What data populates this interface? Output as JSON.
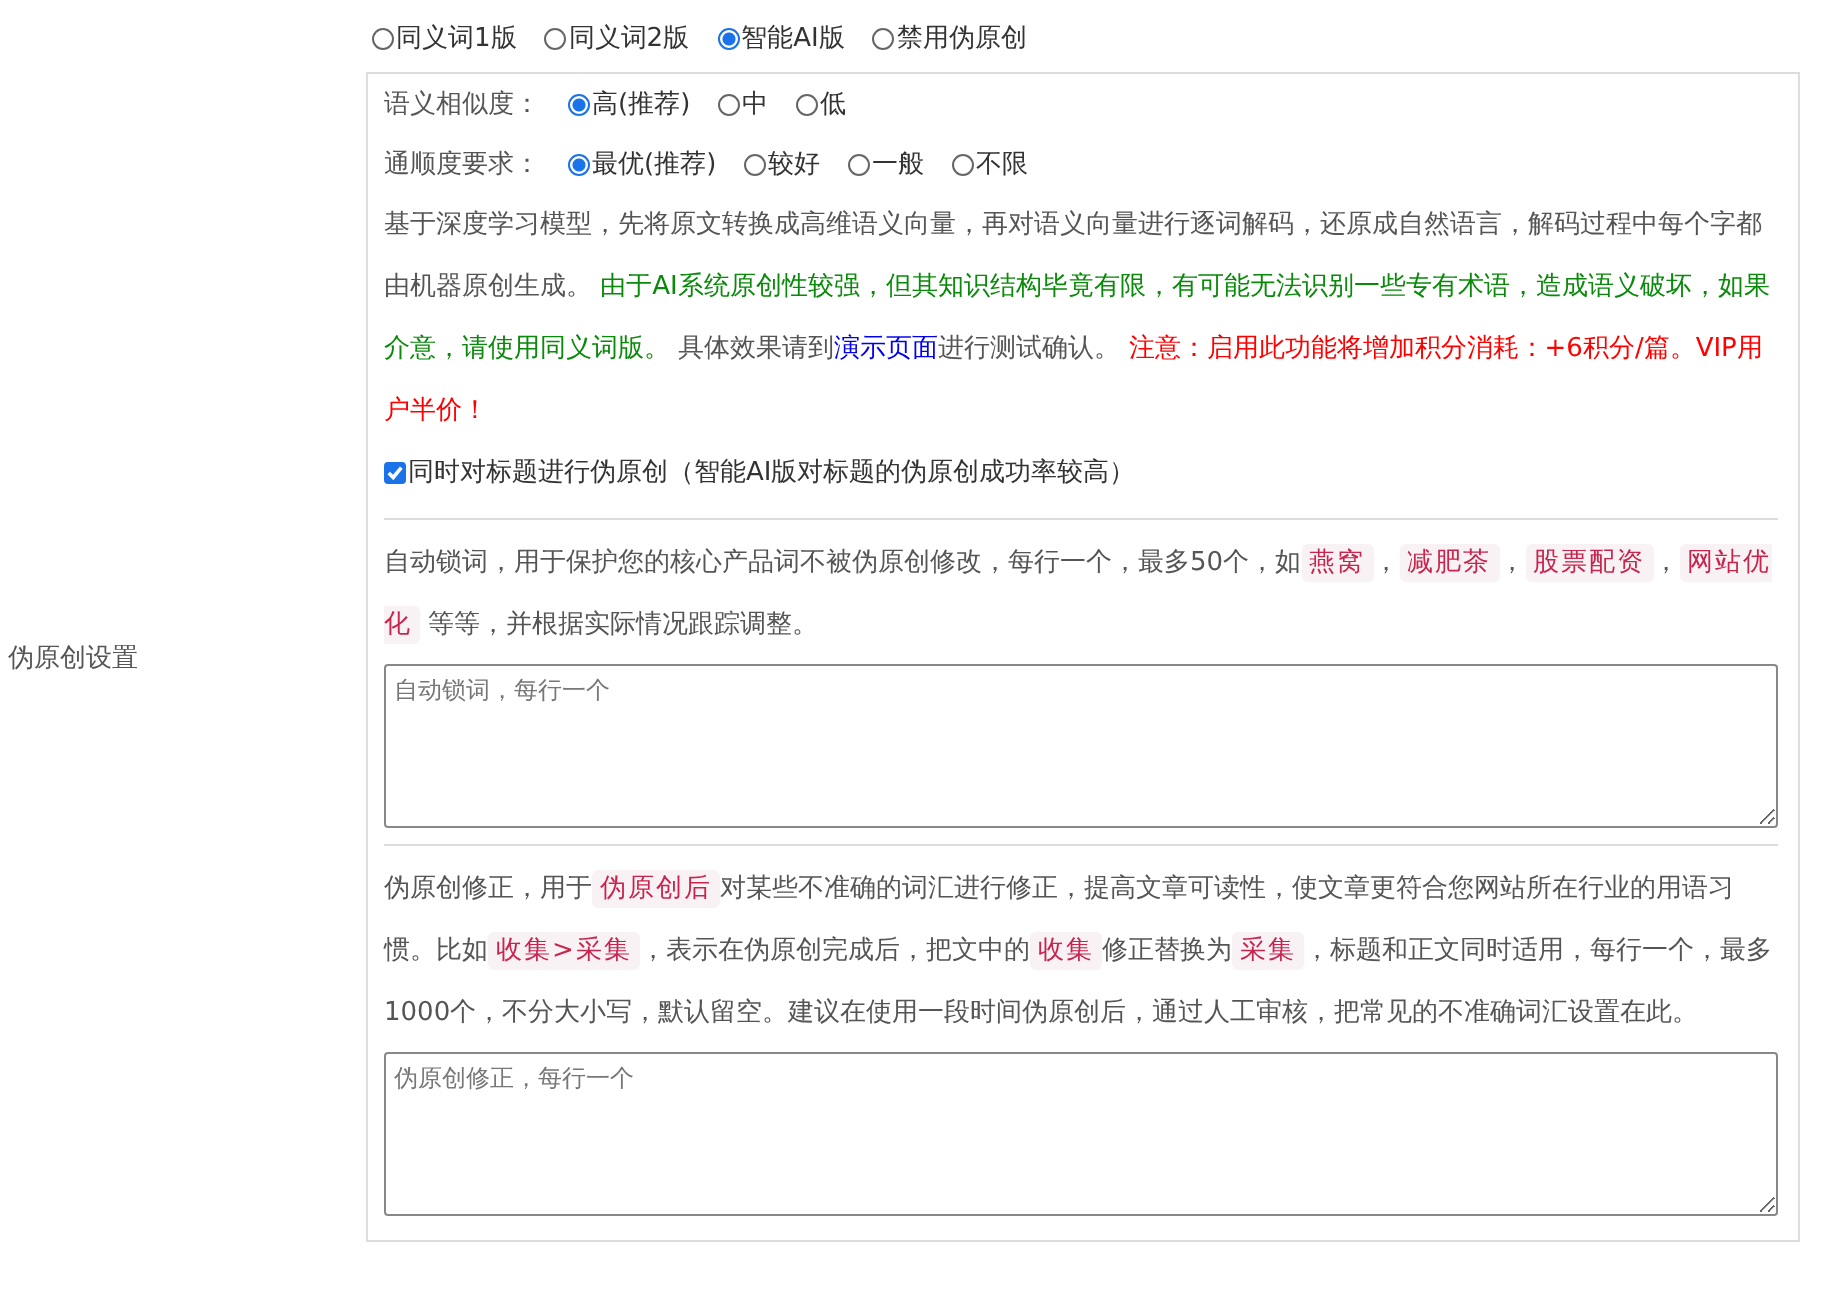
{
  "section_label": "伪原创设置",
  "modes": [
    {
      "label": "同义词1版",
      "selected": false
    },
    {
      "label": "同义词2版",
      "selected": false
    },
    {
      "label": "智能AI版",
      "selected": true
    },
    {
      "label": "禁用伪原创",
      "selected": false
    }
  ],
  "similarity": {
    "label": "语义相似度：",
    "options": [
      {
        "label": "高(推荐)",
        "selected": true
      },
      {
        "label": "中",
        "selected": false
      },
      {
        "label": "低",
        "selected": false
      }
    ]
  },
  "fluency": {
    "label": "通顺度要求：",
    "options": [
      {
        "label": "最优(推荐)",
        "selected": true
      },
      {
        "label": "较好",
        "selected": false
      },
      {
        "label": "一般",
        "selected": false
      },
      {
        "label": "不限",
        "selected": false
      }
    ]
  },
  "ai_description": [
    {
      "kind": "plain",
      "text": "基于深度学习模型，先将原文转换成高维语义向量，再对语义向量进行逐词解码，还原成自然语言，解码过程中每个字都由机器原创生成。 "
    },
    {
      "kind": "green",
      "text": "由于AI系统原创性较强，但其知识结构毕竟有限，有可能无法识别一些专有术语，造成语义破坏，如果介意，请使用同义词版。"
    },
    {
      "kind": "plain",
      "text": " 具体效果请到"
    },
    {
      "kind": "link",
      "text": "演示页面"
    },
    {
      "kind": "plain",
      "text": "进行测试确认。 "
    },
    {
      "kind": "red",
      "text": "注意：启用此功能将增加积分消耗：+6积分/篇。VIP用户半价！"
    }
  ],
  "title_option": {
    "label": "同时对标题进行伪原创（智能AI版对标题的伪原创成功率较高）",
    "checked": true
  },
  "lock_words": {
    "description": [
      {
        "kind": "plain",
        "text": "自动锁词，用于保护您的核心产品词不被伪原创修改，每行一个，最多50个，如"
      },
      {
        "kind": "tag",
        "text": "燕窝"
      },
      {
        "kind": "plain",
        "text": "，"
      },
      {
        "kind": "tag",
        "text": "减肥茶"
      },
      {
        "kind": "plain",
        "text": "，"
      },
      {
        "kind": "tag",
        "text": "股票配资"
      },
      {
        "kind": "plain",
        "text": "，"
      },
      {
        "kind": "tag",
        "text": "网站优化"
      },
      {
        "kind": "plain",
        "text": " 等等，并根据实际情况跟踪调整。"
      }
    ],
    "placeholder": "自动锁词，每行一个"
  },
  "corrections": {
    "description": [
      {
        "kind": "plain",
        "text": "伪原创修正，用于"
      },
      {
        "kind": "tag",
        "text": "伪原创后"
      },
      {
        "kind": "plain",
        "text": "对某些不准确的词汇进行修正，提高文章可读性，使文章更符合您网站所在行业的用语习惯。比如"
      },
      {
        "kind": "tag",
        "text": "收集>采集"
      },
      {
        "kind": "plain",
        "text": "，表示在伪原创完成后，把文中的"
      },
      {
        "kind": "tag",
        "text": "收集"
      },
      {
        "kind": "plain",
        "text": "修正替换为"
      },
      {
        "kind": "tag",
        "text": "采集"
      },
      {
        "kind": "plain",
        "text": "，标题和正文同时适用，每行一个，最多1000个，不分大小写，默认留空。建议在使用一段时间伪原创后，通过人工审核，把常见的不准确词汇设置在此。"
      }
    ],
    "placeholder": "伪原创修正，每行一个"
  }
}
